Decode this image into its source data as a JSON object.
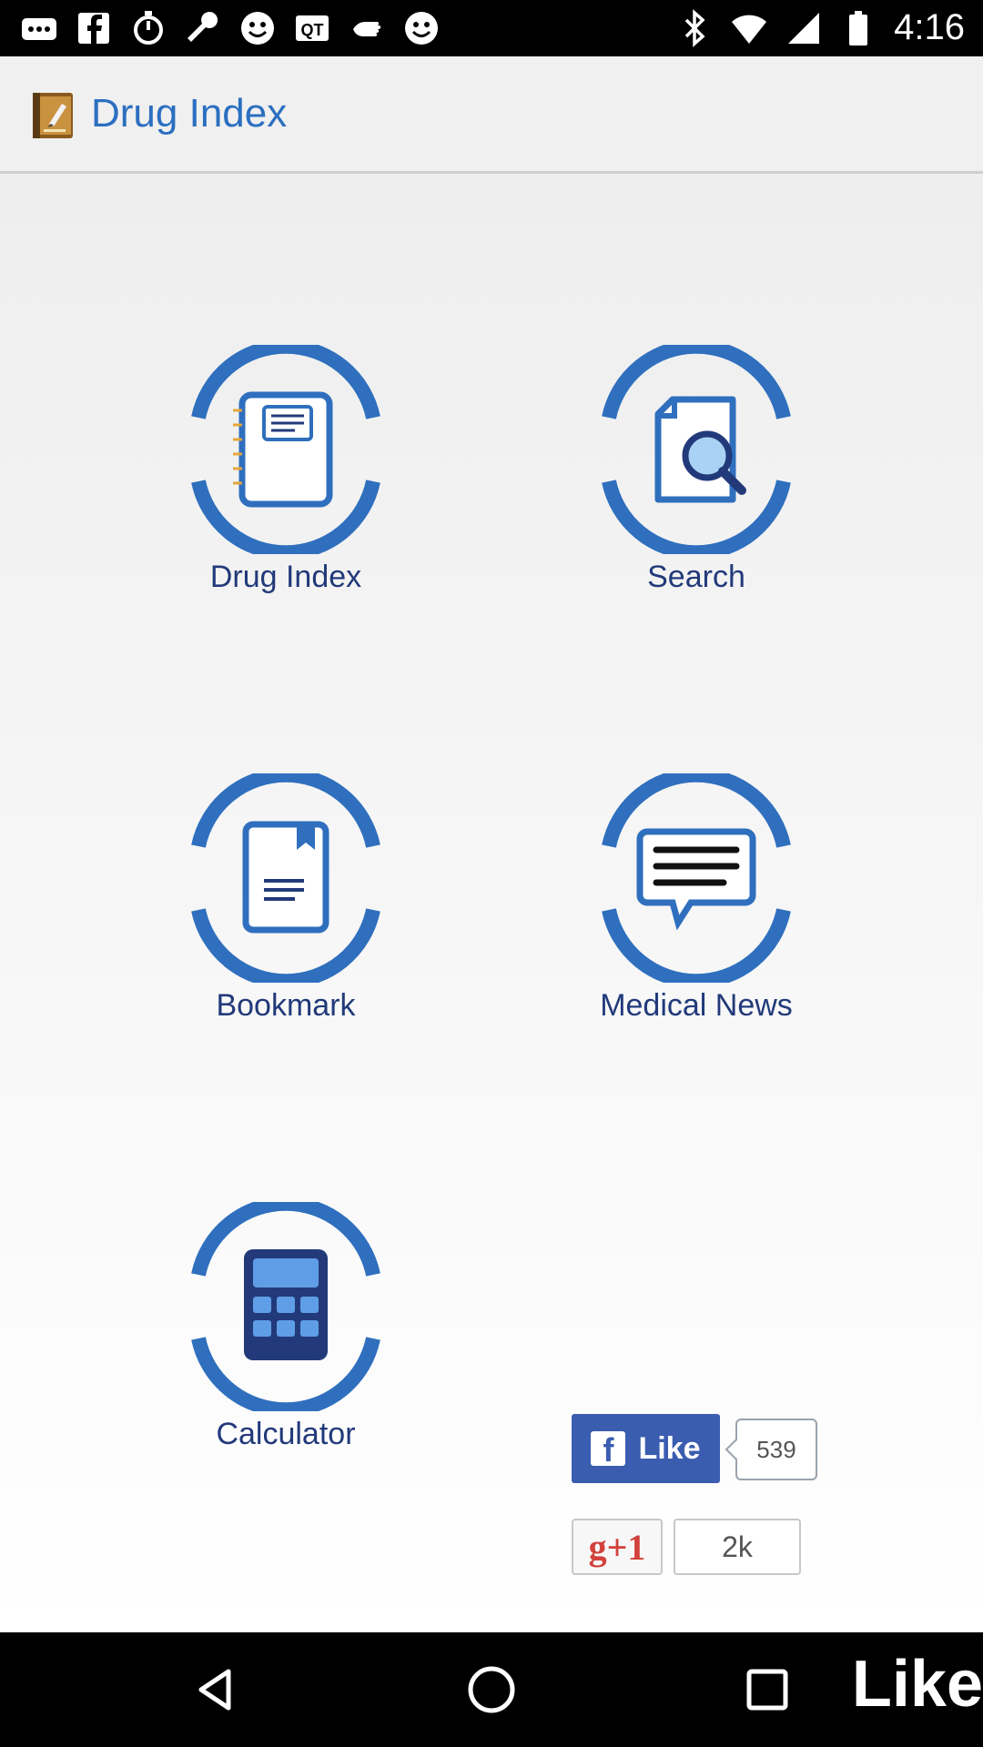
{
  "status_bar": {
    "time": "4:16",
    "icons": [
      "more-icon",
      "facebook-icon",
      "timer-icon",
      "wrench-icon",
      "smiley-icon",
      "qt-icon",
      "hand-icon",
      "smiley-icon",
      "bluetooth-icon",
      "wifi-icon",
      "signal-icon",
      "battery-icon"
    ]
  },
  "app_bar": {
    "title": "Drug Index",
    "logo": "drug-index-logo"
  },
  "menu": {
    "drug_index": "Drug Index",
    "search": "Search",
    "bookmark": "Bookmark",
    "medical_news": "Medical News",
    "calculator": "Calculator"
  },
  "social": {
    "fb_like_label": "Like",
    "fb_count": "539",
    "gplus_label": "g+1",
    "gplus_count": "2k"
  },
  "nav_bar": {
    "right_text": "Like"
  },
  "colors": {
    "accent": "#2c6fc0",
    "label": "#223a7a",
    "facebook": "#3b5db0",
    "gplus": "#d2413b"
  }
}
